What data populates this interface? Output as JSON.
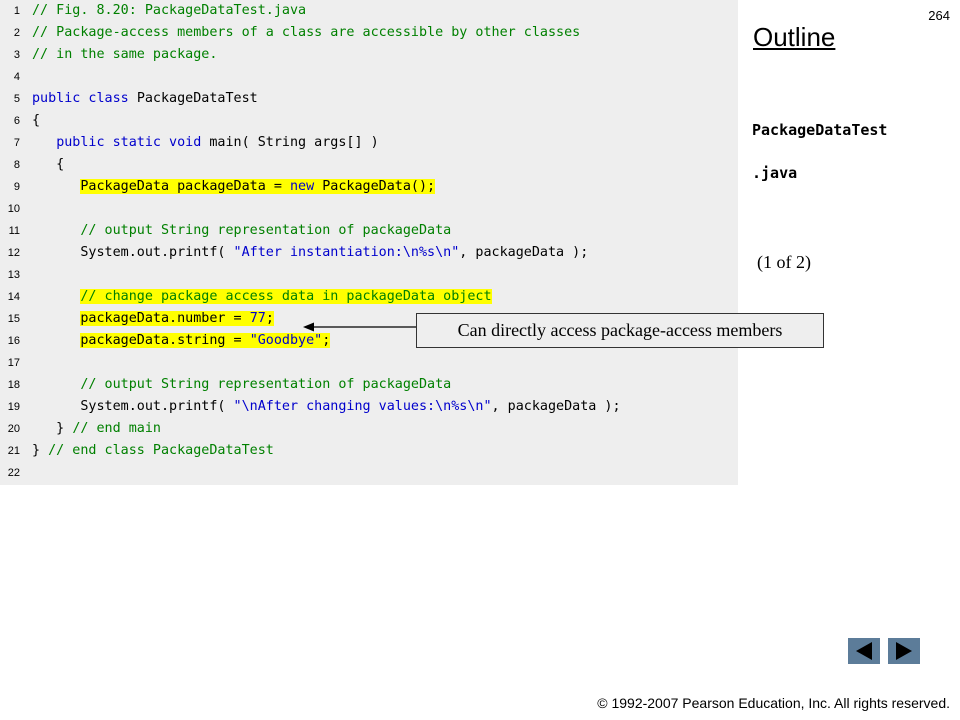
{
  "code": {
    "lines": [
      {
        "n": "1",
        "hl": false,
        "tokens": [
          {
            "t": "// Fig. 8.20: PackageDataTest.java",
            "c": "comment"
          }
        ]
      },
      {
        "n": "2",
        "hl": false,
        "tokens": [
          {
            "t": "// Package-access members of a class are accessible by other classes",
            "c": "comment"
          }
        ]
      },
      {
        "n": "3",
        "hl": false,
        "tokens": [
          {
            "t": "// in the same package.",
            "c": "comment"
          }
        ]
      },
      {
        "n": "4",
        "hl": false,
        "tokens": []
      },
      {
        "n": "5",
        "hl": false,
        "tokens": [
          {
            "t": "public class ",
            "c": "keyword"
          },
          {
            "t": "PackageDataTest",
            "c": "plain"
          }
        ]
      },
      {
        "n": "6",
        "hl": false,
        "tokens": [
          {
            "t": "{",
            "c": "plain"
          }
        ]
      },
      {
        "n": "7",
        "hl": false,
        "tokens": [
          {
            "t": "   ",
            "c": "plain"
          },
          {
            "t": "public static void ",
            "c": "keyword"
          },
          {
            "t": "main( String args[] )",
            "c": "plain"
          }
        ]
      },
      {
        "n": "8",
        "hl": false,
        "tokens": [
          {
            "t": "   {",
            "c": "plain"
          }
        ]
      },
      {
        "n": "9",
        "hl": true,
        "tokens": [
          {
            "t": "      ",
            "c": "plain"
          },
          {
            "t": "PackageData packageData = ",
            "c": "plain"
          },
          {
            "t": "new ",
            "c": "keyword"
          },
          {
            "t": "PackageData();",
            "c": "plain"
          }
        ]
      },
      {
        "n": "10",
        "hl": false,
        "tokens": []
      },
      {
        "n": "11",
        "hl": false,
        "tokens": [
          {
            "t": "      ",
            "c": "plain"
          },
          {
            "t": "// output String representation of packageData",
            "c": "comment"
          }
        ]
      },
      {
        "n": "12",
        "hl": false,
        "tokens": [
          {
            "t": "      System.out.printf( ",
            "c": "plain"
          },
          {
            "t": "\"After instantiation:\\n%s\\n\"",
            "c": "string"
          },
          {
            "t": ", packageData );",
            "c": "plain"
          }
        ]
      },
      {
        "n": "13",
        "hl": false,
        "tokens": []
      },
      {
        "n": "14",
        "hl": true,
        "tokens": [
          {
            "t": "      ",
            "c": "plain"
          },
          {
            "t": "// change package access data in packageData object",
            "c": "comment"
          }
        ]
      },
      {
        "n": "15",
        "hl": true,
        "tokens": [
          {
            "t": "      ",
            "c": "plain"
          },
          {
            "t": "packageData.number = ",
            "c": "plain"
          },
          {
            "t": "77",
            "c": "string"
          },
          {
            "t": ";",
            "c": "plain"
          }
        ]
      },
      {
        "n": "16",
        "hl": true,
        "tokens": [
          {
            "t": "      ",
            "c": "plain"
          },
          {
            "t": "packageData.string = ",
            "c": "plain"
          },
          {
            "t": "\"Goodbye\"",
            "c": "string"
          },
          {
            "t": ";",
            "c": "plain"
          }
        ]
      },
      {
        "n": "17",
        "hl": false,
        "tokens": []
      },
      {
        "n": "18",
        "hl": false,
        "tokens": [
          {
            "t": "      ",
            "c": "plain"
          },
          {
            "t": "// output String representation of packageData",
            "c": "comment"
          }
        ]
      },
      {
        "n": "19",
        "hl": false,
        "tokens": [
          {
            "t": "      System.out.printf( ",
            "c": "plain"
          },
          {
            "t": "\"\\nAfter changing values:\\n%s\\n\"",
            "c": "string"
          },
          {
            "t": ", packageData );",
            "c": "plain"
          }
        ]
      },
      {
        "n": "20",
        "hl": false,
        "tokens": [
          {
            "t": "   } ",
            "c": "plain"
          },
          {
            "t": "// end main",
            "c": "comment"
          }
        ]
      },
      {
        "n": "21",
        "hl": false,
        "tokens": [
          {
            "t": "} ",
            "c": "plain"
          },
          {
            "t": "// end class PackageDataTest",
            "c": "comment"
          }
        ]
      },
      {
        "n": "22",
        "hl": false,
        "tokens": []
      }
    ]
  },
  "sidebar": {
    "page_number": "264",
    "outline_title": "Outline",
    "file_name_line1": "PackageDataTest",
    "file_name_line2": ".java",
    "part_label": "(1 of 2)"
  },
  "callout": {
    "text": "Can directly access package-access  members"
  },
  "nav": {
    "prev_icon": "triangle-left-icon",
    "next_icon": "triangle-right-icon",
    "button_color": "#5c7c99"
  },
  "footer": {
    "copyright": "© 1992-2007 Pearson Education, Inc.  All rights reserved."
  },
  "colors": {
    "comment": "#008000",
    "keyword": "#0000cc",
    "highlight": "#ffff00",
    "code_background": "#eeeeee"
  }
}
